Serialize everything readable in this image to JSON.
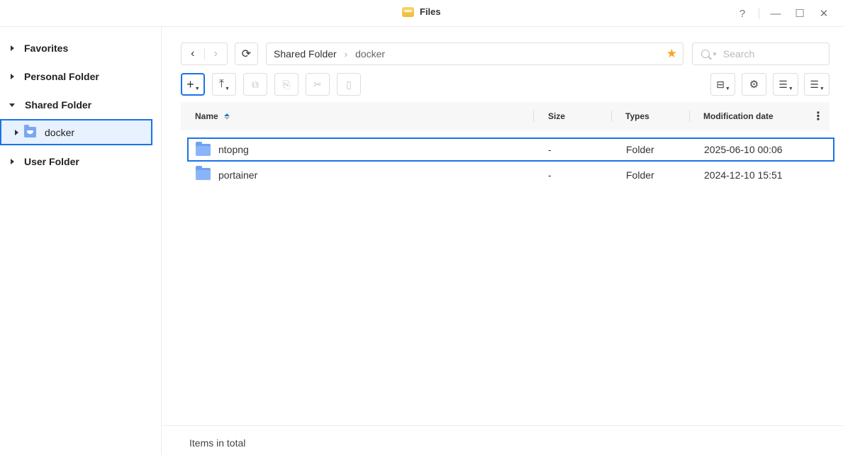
{
  "window": {
    "title": "Files",
    "controls": {
      "help": "?",
      "minimize": "—",
      "maximize": "☐",
      "close": "✕"
    }
  },
  "sidebar": {
    "items": [
      {
        "label": "Favorites",
        "expanded": false
      },
      {
        "label": "Personal Folder",
        "expanded": false
      },
      {
        "label": "Shared Folder",
        "expanded": true
      },
      {
        "label": "User Folder",
        "expanded": false
      }
    ],
    "selected_child": {
      "label": "docker",
      "icon": "docker-folder-icon"
    }
  },
  "toolbar": {
    "back": "‹",
    "forward": "›",
    "refresh": "⟳",
    "breadcrumb": [
      "Shared Folder",
      "docker"
    ],
    "favorite_star": "★",
    "search_placeholder": "Search",
    "create": "+",
    "upload": "⤒",
    "copy": "⧉",
    "paste": "⎘",
    "cut": "✂",
    "properties": "▯",
    "tools": "⊟",
    "settings": "⚙",
    "view_list": "☰",
    "sort": "☰"
  },
  "table": {
    "columns": {
      "name": "Name",
      "size": "Size",
      "types": "Types",
      "modified": "Modification date"
    },
    "more": "⋮",
    "rows": [
      {
        "name": "ntopng",
        "size": "-",
        "type": "Folder",
        "modified": "2025-06-10 00:06",
        "selected": true
      },
      {
        "name": "portainer",
        "size": "-",
        "type": "Folder",
        "modified": "2024-12-10 15:51",
        "selected": false
      }
    ]
  },
  "footer": {
    "text": "Items in total"
  },
  "colors": {
    "accent": "#1a73e8",
    "star": "#f5a623",
    "folder": "#8ab4f8"
  }
}
